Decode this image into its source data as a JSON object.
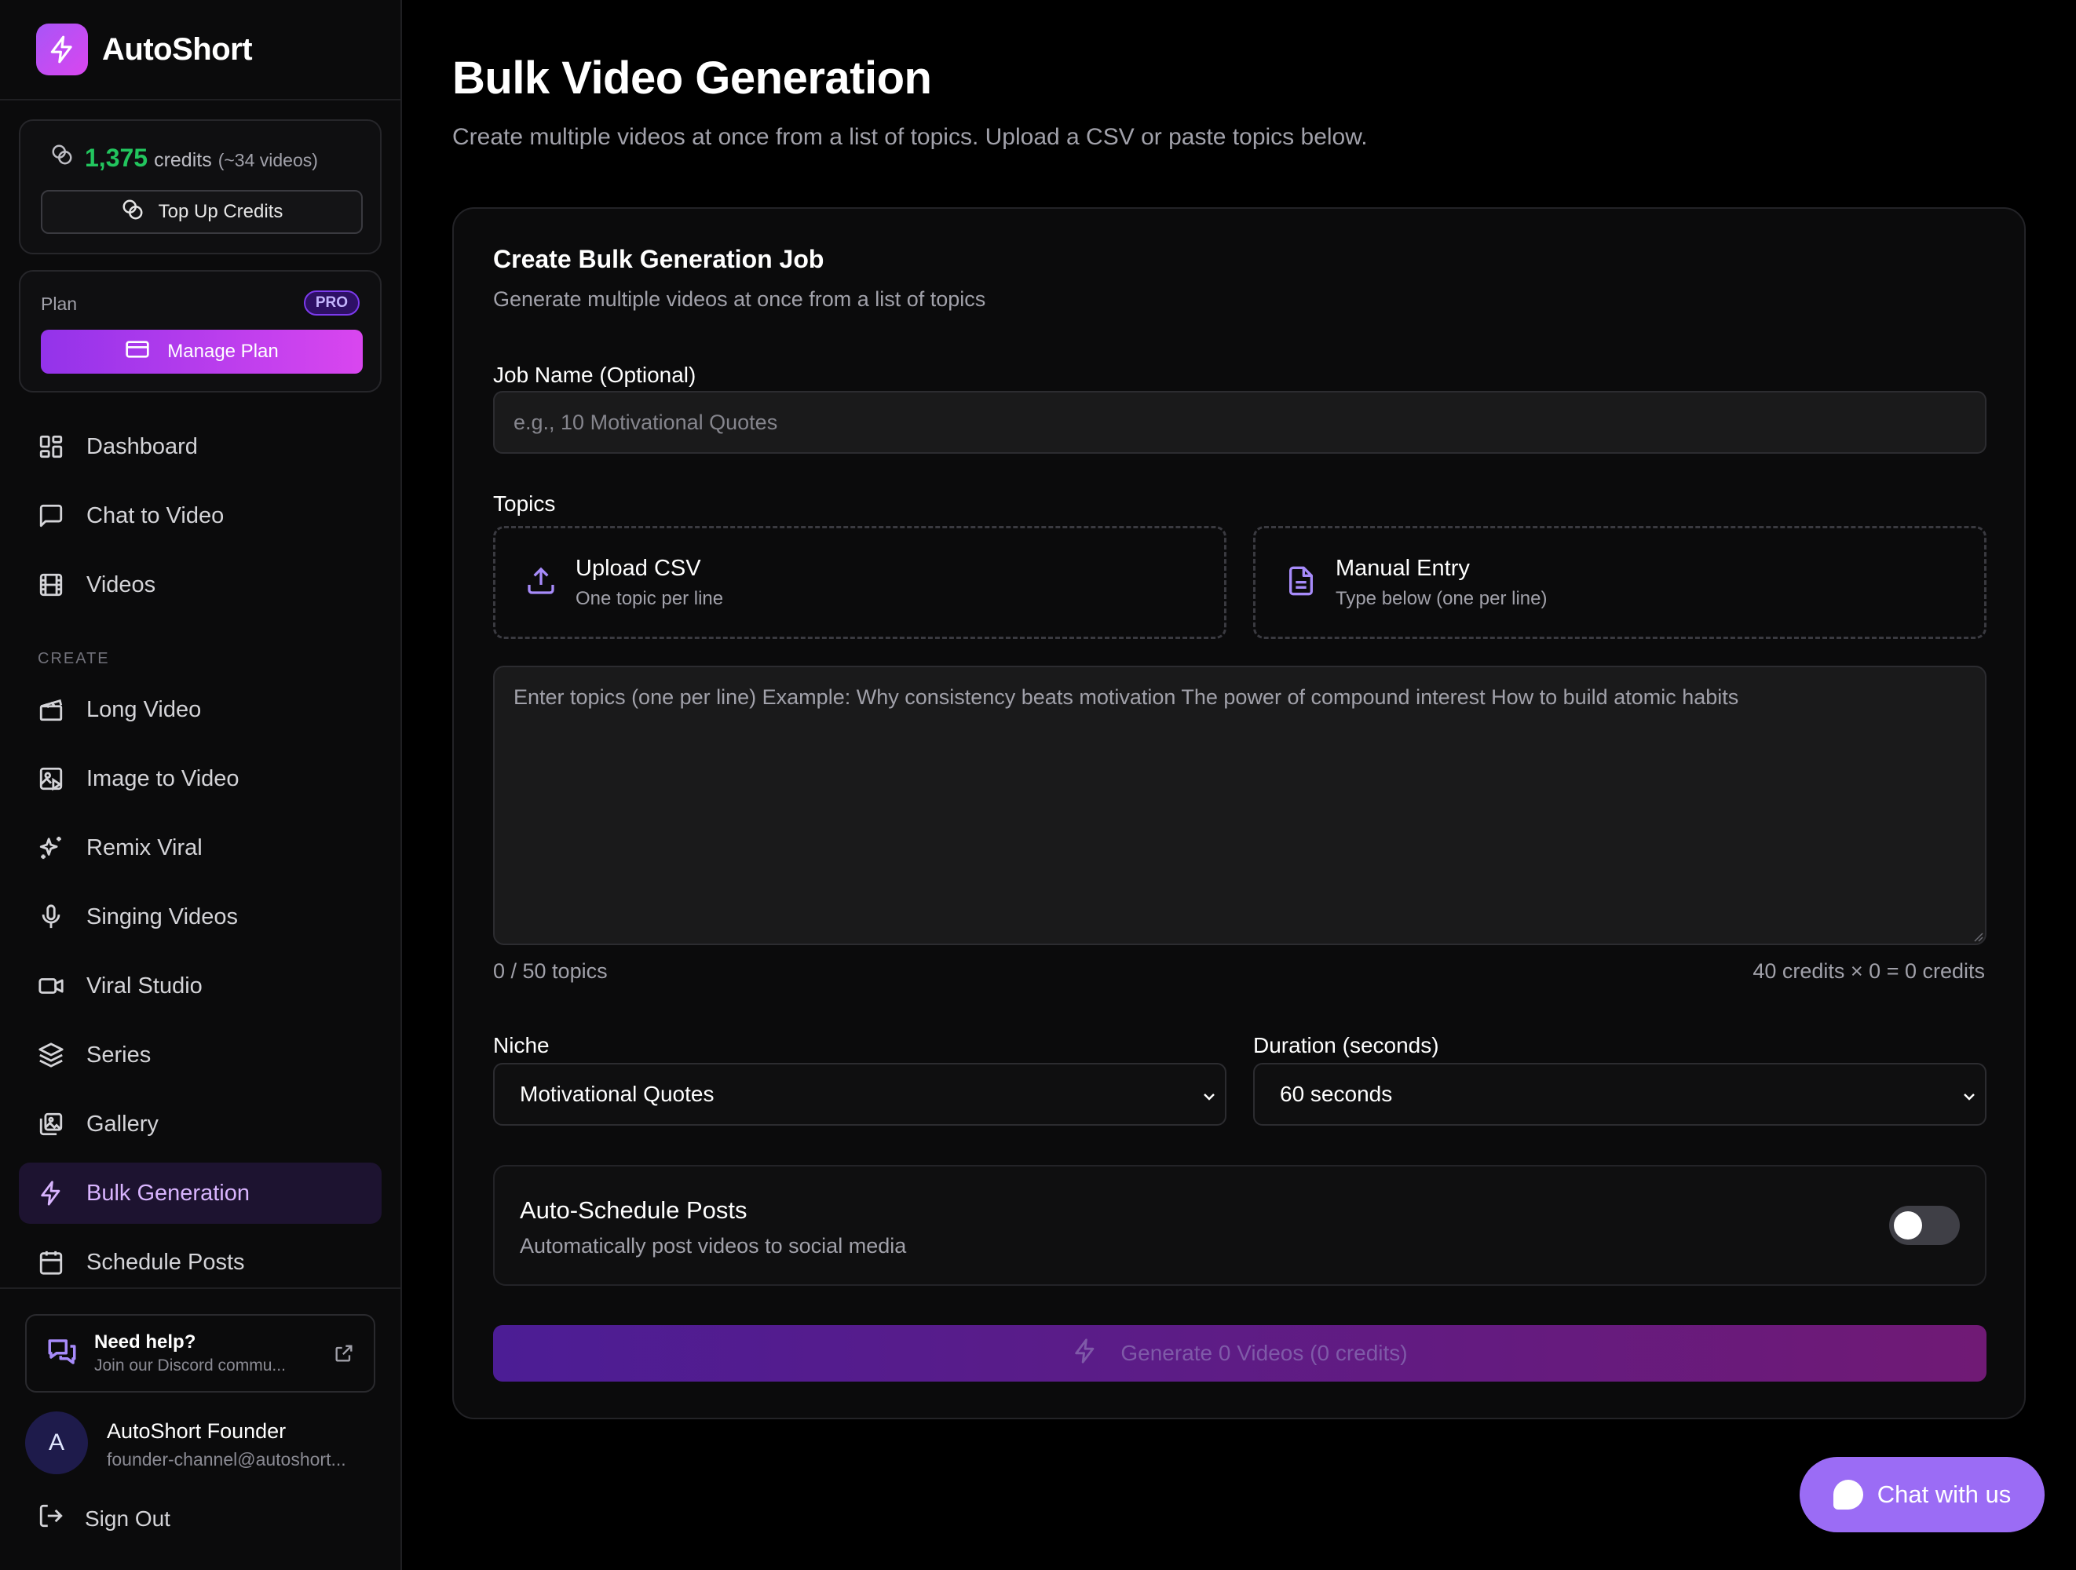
{
  "app": {
    "name": "AutoShort"
  },
  "credits": {
    "amount": "1,375",
    "label": "credits",
    "approx": "(~34 videos)",
    "topup_label": "Top Up Credits"
  },
  "plan": {
    "label": "Plan",
    "badge": "PRO",
    "manage_label": "Manage Plan"
  },
  "nav": {
    "main": [
      {
        "label": "Dashboard",
        "icon": "dashboard-icon"
      },
      {
        "label": "Chat to Video",
        "icon": "chat-icon"
      },
      {
        "label": "Videos",
        "icon": "film-icon"
      }
    ],
    "section_label": "CREATE",
    "create": [
      {
        "label": "Long Video",
        "icon": "clapperboard-icon"
      },
      {
        "label": "Image to Video",
        "icon": "image-play-icon"
      },
      {
        "label": "Remix Viral",
        "icon": "sparkles-icon"
      },
      {
        "label": "Singing Videos",
        "icon": "microphone-icon"
      },
      {
        "label": "Viral Studio",
        "icon": "video-camera-icon"
      },
      {
        "label": "Series",
        "icon": "layers-icon"
      },
      {
        "label": "Gallery",
        "icon": "gallery-icon"
      },
      {
        "label": "Bulk Generation",
        "icon": "lightning-icon",
        "active": true
      },
      {
        "label": "Schedule Posts",
        "icon": "calendar-icon"
      }
    ]
  },
  "help": {
    "title": "Need help?",
    "subtitle": "Join our Discord commu..."
  },
  "user": {
    "initial": "A",
    "name": "AutoShort Founder",
    "email": "founder-channel@autoshort..."
  },
  "signout_label": "Sign Out",
  "page": {
    "title": "Bulk Video Generation",
    "subtitle": "Create multiple videos at once from a list of topics. Upload a CSV or paste topics below."
  },
  "job": {
    "title": "Create Bulk Generation Job",
    "subtitle": "Generate multiple videos at once from a list of topics",
    "name_label": "Job Name (Optional)",
    "name_placeholder": "e.g., 10 Motivational Quotes",
    "name_value": "",
    "topics_label": "Topics",
    "upload": {
      "title": "Upload CSV",
      "subtitle": "One topic per line"
    },
    "manual": {
      "title": "Manual Entry",
      "subtitle": "Type below (one per line)"
    },
    "topics_placeholder": "Enter topics (one per line) Example: Why consistency beats motivation The power of compound interest How to build atomic habits",
    "topics_count": "0 / 50 topics",
    "credits_calc": "40 credits × 0 = 0 credits",
    "niche_label": "Niche",
    "niche_value": "Motivational Quotes",
    "duration_label": "Duration (seconds)",
    "duration_value": "60 seconds",
    "schedule": {
      "title": "Auto-Schedule Posts",
      "subtitle": "Automatically post videos to social media",
      "enabled": false
    },
    "generate_label": "Generate 0 Videos (0 credits)"
  },
  "chat_widget": {
    "label": "Chat with us"
  },
  "colors": {
    "accent": "#a855f7",
    "credits": "#22c55e",
    "background": "#000000"
  }
}
